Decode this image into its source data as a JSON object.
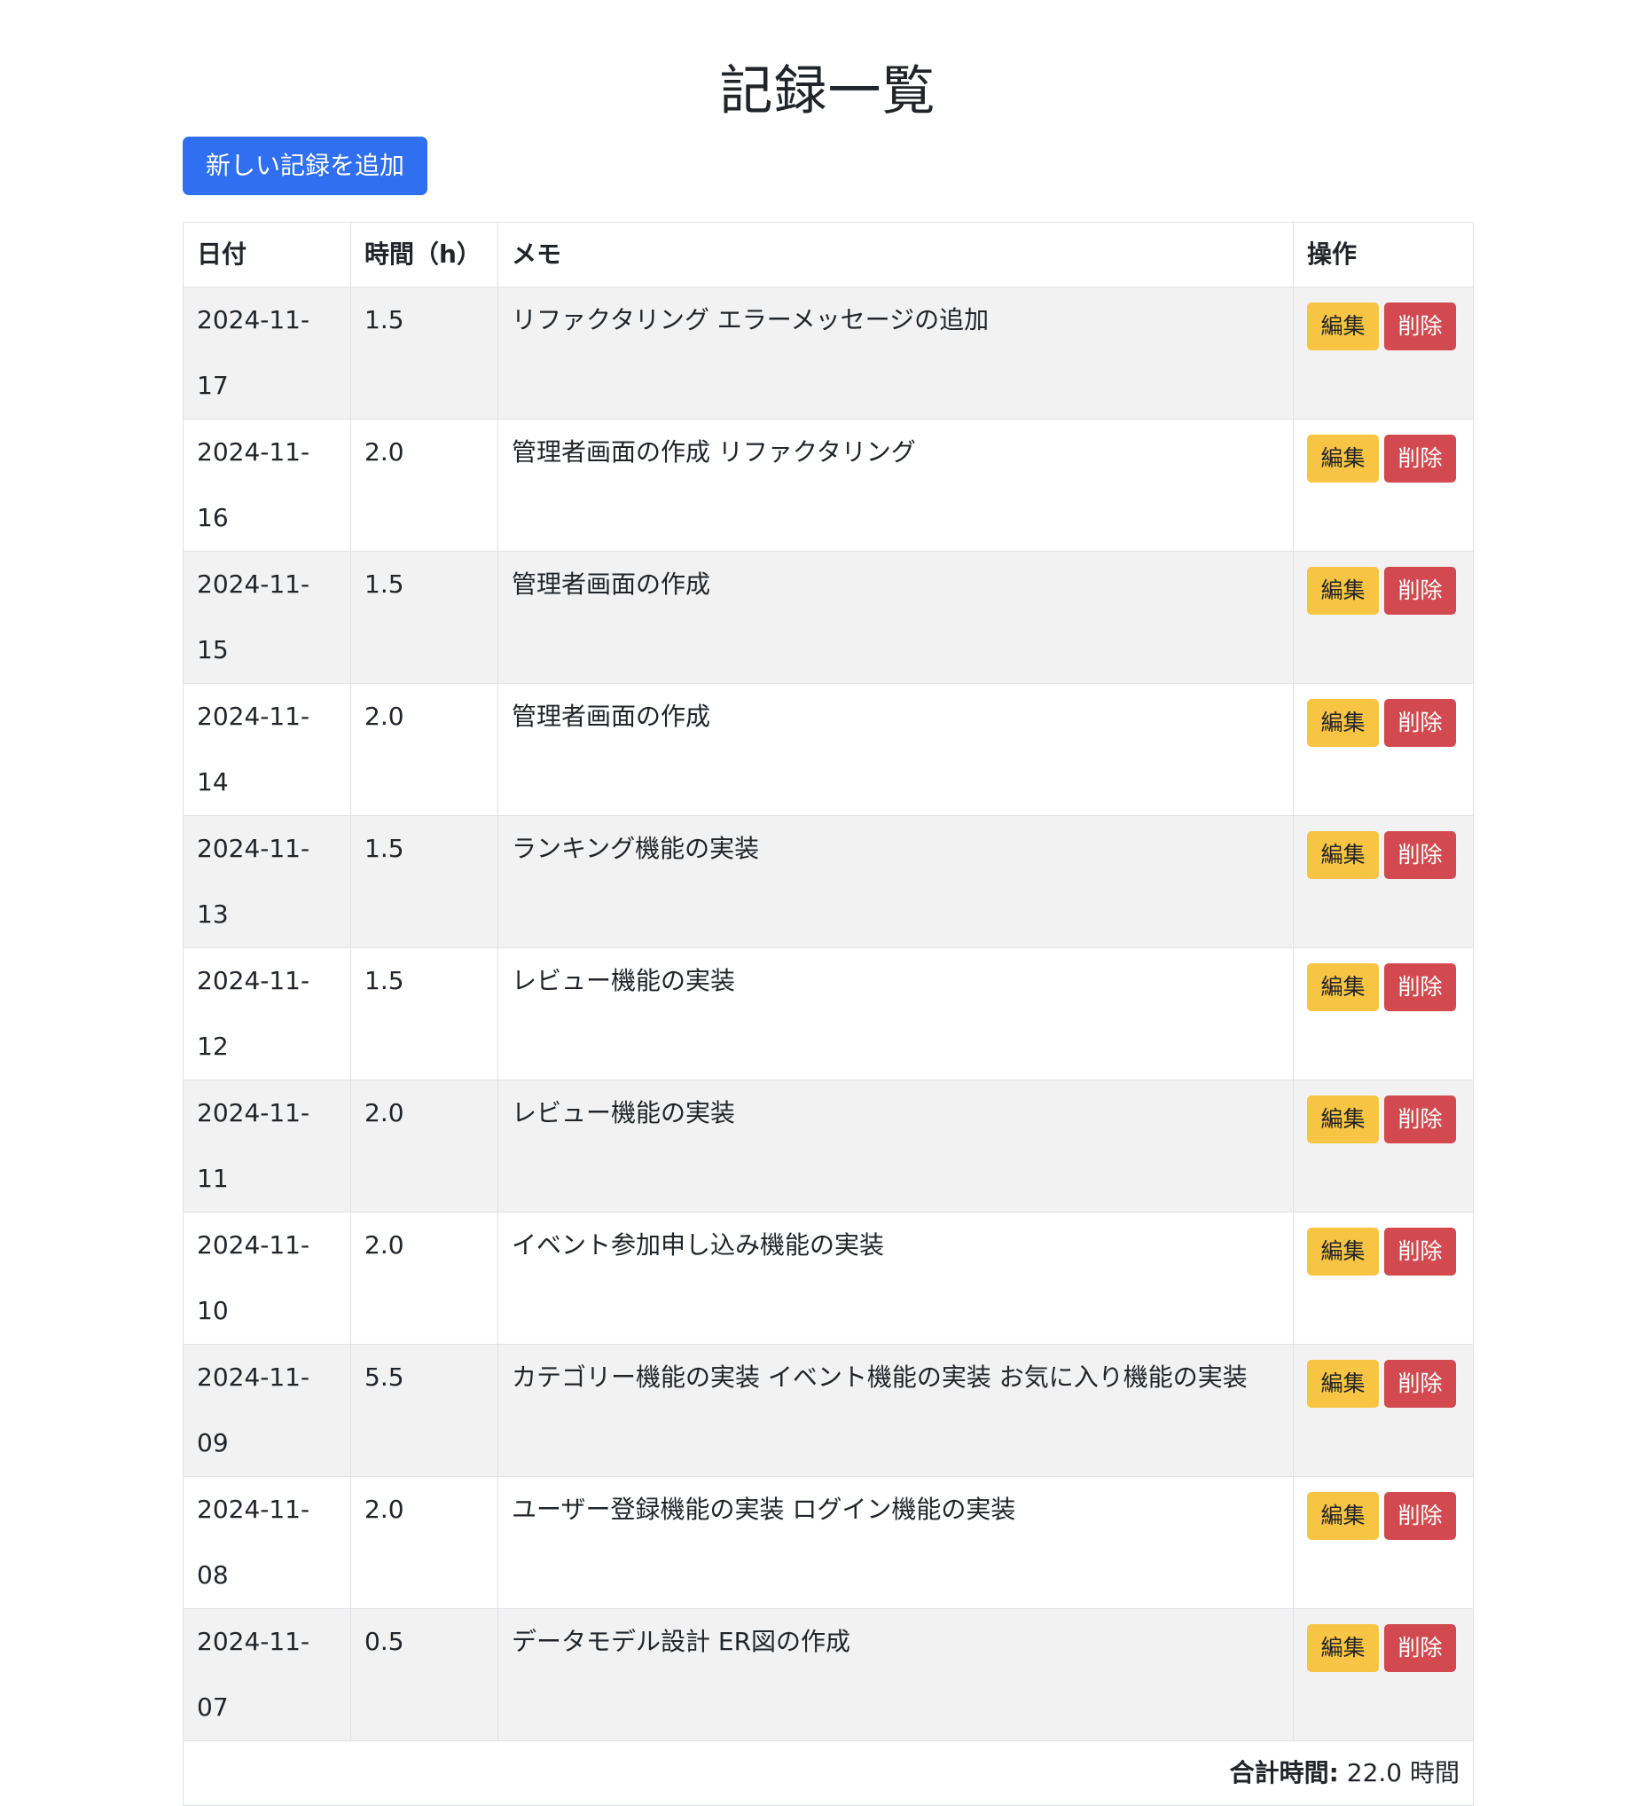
{
  "page": {
    "title": "記録一覧",
    "add_button_label": "新しい記録を追加"
  },
  "table": {
    "headers": {
      "date": "日付",
      "hours": "時間（h）",
      "memo": "メモ",
      "actions": "操作"
    },
    "edit_label": "編集",
    "delete_label": "削除",
    "rows": [
      {
        "date": "2024-11-17",
        "hours": "1.5",
        "memo": "リファクタリング エラーメッセージの追加"
      },
      {
        "date": "2024-11-16",
        "hours": "2.0",
        "memo": "管理者画面の作成 リファクタリング"
      },
      {
        "date": "2024-11-15",
        "hours": "1.5",
        "memo": "管理者画面の作成"
      },
      {
        "date": "2024-11-14",
        "hours": "2.0",
        "memo": "管理者画面の作成"
      },
      {
        "date": "2024-11-13",
        "hours": "1.5",
        "memo": "ランキング機能の実装"
      },
      {
        "date": "2024-11-12",
        "hours": "1.5",
        "memo": "レビュー機能の実装"
      },
      {
        "date": "2024-11-11",
        "hours": "2.0",
        "memo": "レビュー機能の実装"
      },
      {
        "date": "2024-11-10",
        "hours": "2.0",
        "memo": "イベント参加申し込み機能の実装"
      },
      {
        "date": "2024-11-09",
        "hours": "5.5",
        "memo": "カテゴリー機能の実装 イベント機能の実装 お気に入り機能の実装"
      },
      {
        "date": "2024-11-08",
        "hours": "2.0",
        "memo": "ユーザー登録機能の実装 ログイン機能の実装"
      },
      {
        "date": "2024-11-07",
        "hours": "0.5",
        "memo": "データモデル設計 ER図の作成"
      }
    ],
    "total": {
      "label": "合計時間:",
      "value": "22.0 時間"
    }
  },
  "colors": {
    "primary": "#2f6ff0",
    "warning": "#f7c443",
    "danger": "#d24a4f",
    "stripe": "#f2f2f2"
  }
}
